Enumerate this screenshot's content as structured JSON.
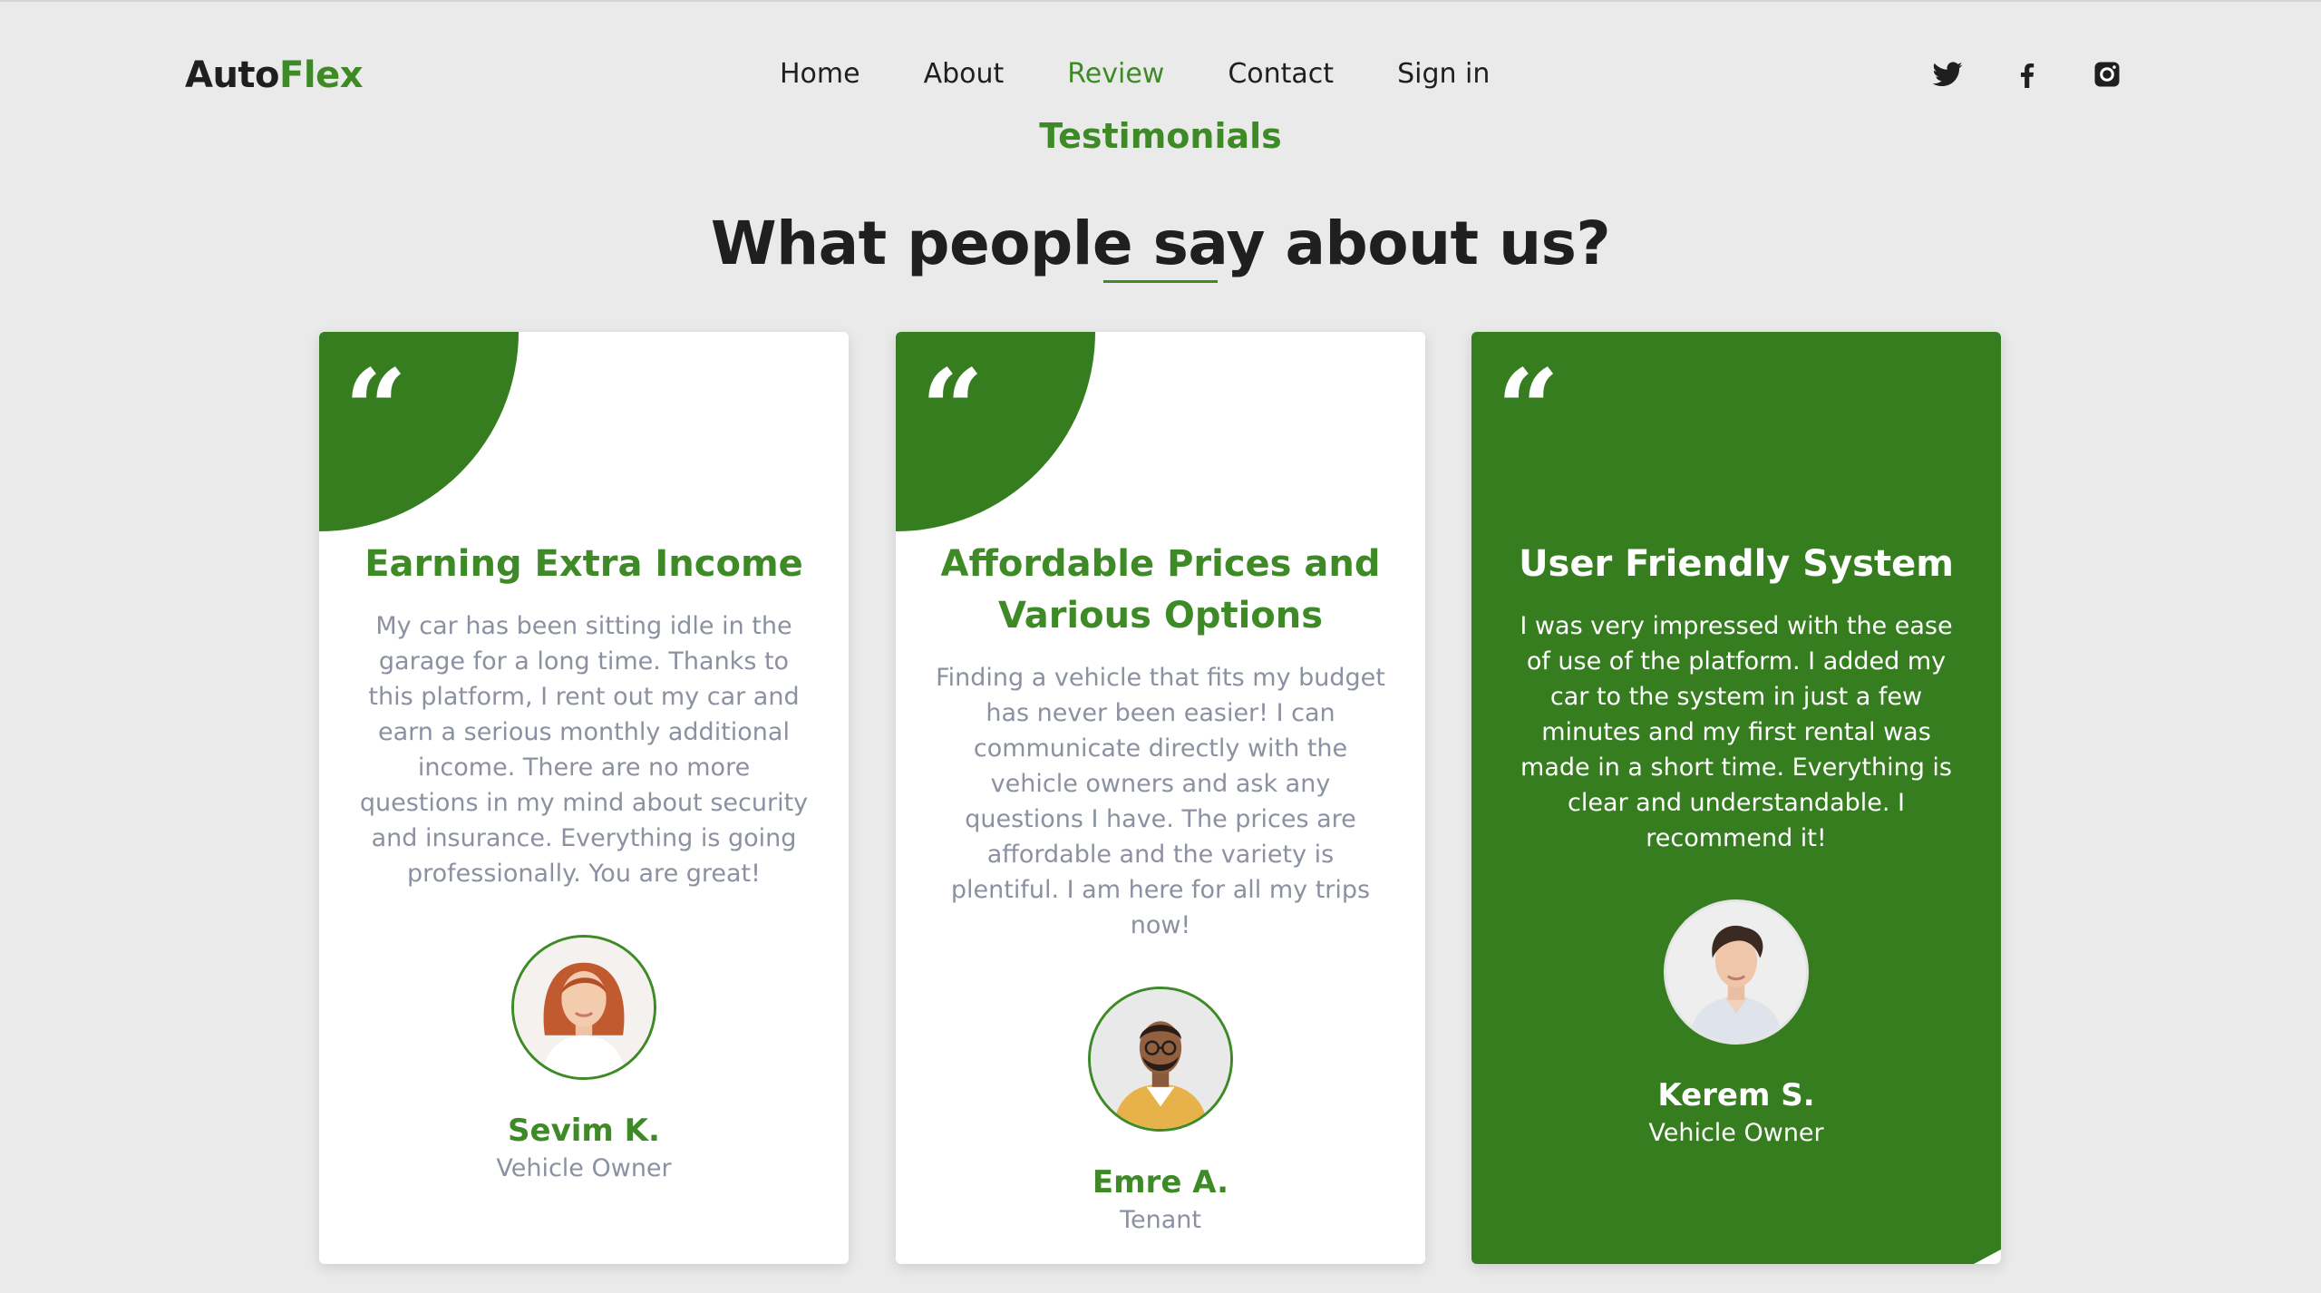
{
  "brand": {
    "part1": "Auto",
    "part2": "Flex",
    "accent_color": "#3d8a26"
  },
  "nav": {
    "items": [
      {
        "label": "Home",
        "active": false
      },
      {
        "label": "About",
        "active": false
      },
      {
        "label": "Review",
        "active": true
      },
      {
        "label": "Contact",
        "active": false
      },
      {
        "label": "Sign in",
        "active": false
      }
    ]
  },
  "social": {
    "icons": [
      "twitter-icon",
      "facebook-icon",
      "instagram-icon"
    ]
  },
  "section": {
    "eyebrow": "Testimonials",
    "title": "What people say about us?"
  },
  "cards": [
    {
      "title": "Earning Extra Income",
      "text": "My car has been sitting idle in the garage for a long time. Thanks to this platform, I rent out my car and earn a serious monthly additional income. There are no more questions in my mind about security and insurance. Everything is going professionally. You are great!",
      "name": "Sevim K.",
      "role": "Vehicle Owner",
      "avatar": "woman-portrait-icon"
    },
    {
      "title": "Affordable Prices and Various Options",
      "text": "Finding a vehicle that fits my budget has never been easier! I can communicate directly with the vehicle owners and ask any questions I have. The prices are affordable and the variety is plentiful. I am here for all my trips now!",
      "name": "Emre A.",
      "role": "Tenant",
      "avatar": "man-glasses-portrait-icon"
    },
    {
      "title": "User Friendly System",
      "text": "I was very impressed with the ease of use of the platform. I added my car to the system in just a few minutes and my first rental was made in a short time. Everything is clear and understandable. I recommend it!",
      "name": "Kerem S.",
      "role": "Vehicle Owner",
      "avatar": "man-portrait-icon"
    }
  ],
  "colors": {
    "green": "#367d20",
    "background": "#eaeaea",
    "muted_text": "#8b91a0"
  }
}
